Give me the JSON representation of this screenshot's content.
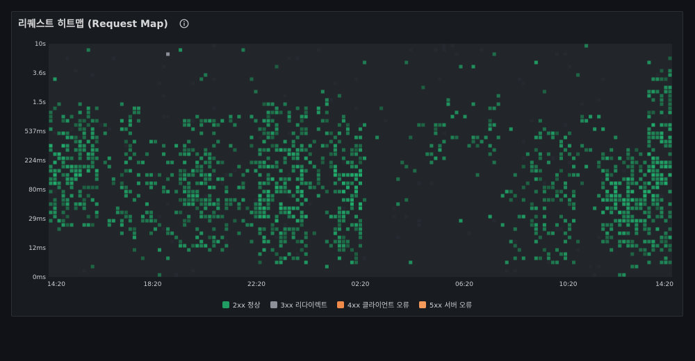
{
  "panel": {
    "title": "리퀘스트 히트맵 (Request Map)",
    "info_icon": "info-circle-icon"
  },
  "colors": {
    "background": "#181b1f",
    "empty_cell": "#22262b",
    "green_low": "#1e5b3f",
    "green_high": "#22c57a",
    "gray": "#8e9099",
    "orange": "#f08a4b",
    "orange_5xx": "#f59a5a"
  },
  "chart_data": {
    "type": "heatmap",
    "x_tick_labels": [
      "14:20",
      "18:20",
      "22:20",
      "02:20",
      "06:20",
      "10:20",
      "14:20"
    ],
    "y_tick_labels": [
      "0ms",
      "12ms",
      "29ms",
      "80ms",
      "224ms",
      "537ms",
      "1.5s",
      "3.6s",
      "10s"
    ],
    "y_scale": "log",
    "columns": 149,
    "rows": 56,
    "grid": true,
    "legend_position": "bottom-center",
    "legend": [
      {
        "label": "2xx 정상",
        "color": "#1f9d62"
      },
      {
        "label": "3xx 리다이렉트",
        "color": "#8e9099"
      },
      {
        "label": "4xx 클라이언트 오류",
        "color": "#f08a4b"
      },
      {
        "label": "5xx 서버 오류",
        "color": "#f59a5a"
      }
    ],
    "activity_profile": [
      {
        "col_from": 0,
        "col_to": 12,
        "density": 0.55,
        "band": [
          0.2,
          0.75
        ]
      },
      {
        "col_from": 12,
        "col_to": 17,
        "density": 0.15,
        "band": [
          0.15,
          0.55
        ]
      },
      {
        "col_from": 17,
        "col_to": 22,
        "density": 0.35,
        "band": [
          0.1,
          0.8
        ]
      },
      {
        "col_from": 22,
        "col_to": 32,
        "density": 0.25,
        "band": [
          0.05,
          0.6
        ]
      },
      {
        "col_from": 32,
        "col_to": 40,
        "density": 0.5,
        "band": [
          0.1,
          0.7
        ]
      },
      {
        "col_from": 40,
        "col_to": 50,
        "density": 0.25,
        "band": [
          0.1,
          0.7
        ]
      },
      {
        "col_from": 50,
        "col_to": 62,
        "density": 0.6,
        "band": [
          0.05,
          0.75
        ]
      },
      {
        "col_from": 62,
        "col_to": 68,
        "density": 0.3,
        "band": [
          0.25,
          0.8
        ]
      },
      {
        "col_from": 68,
        "col_to": 75,
        "density": 0.55,
        "band": [
          0.05,
          0.7
        ]
      },
      {
        "col_from": 75,
        "col_to": 88,
        "density": 0.05,
        "band": [
          0.25,
          0.6
        ]
      },
      {
        "col_from": 88,
        "col_to": 100,
        "density": 0.2,
        "band": [
          0.45,
          0.75
        ]
      },
      {
        "col_from": 100,
        "col_to": 108,
        "density": 0.2,
        "band": [
          0.45,
          0.75
        ]
      },
      {
        "col_from": 108,
        "col_to": 115,
        "density": 0.2,
        "band": [
          0.05,
          0.5
        ]
      },
      {
        "col_from": 115,
        "col_to": 126,
        "density": 0.35,
        "band": [
          0.05,
          0.65
        ]
      },
      {
        "col_from": 126,
        "col_to": 132,
        "density": 0.15,
        "band": [
          0.25,
          0.7
        ]
      },
      {
        "col_from": 132,
        "col_to": 143,
        "density": 0.6,
        "band": [
          0.1,
          0.55
        ]
      },
      {
        "col_from": 143,
        "col_to": 149,
        "density": 0.6,
        "band": [
          0.05,
          0.95
        ]
      }
    ]
  }
}
